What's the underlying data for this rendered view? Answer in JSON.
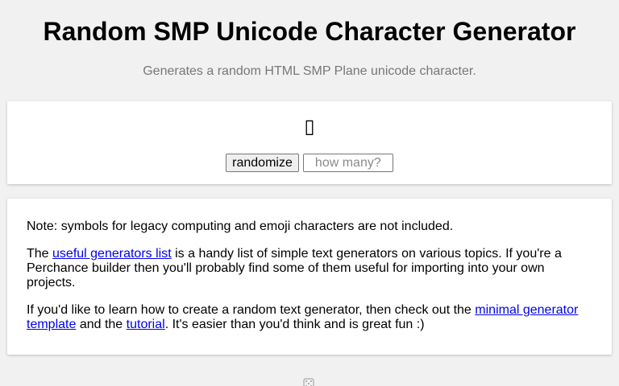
{
  "header": {
    "title": "Random SMP Unicode Character Generator",
    "subtitle": "Generates a random HTML SMP Plane unicode character."
  },
  "output": {
    "character": "▯"
  },
  "controls": {
    "randomize_label": "randomize",
    "how_many_placeholder": "how many?"
  },
  "notes": {
    "note": "Note: symbols for legacy computing and emoji characters are not included.",
    "p2_before": "The ",
    "p2_link": "useful generators list",
    "p2_after": " is a handy list of simple text generators on various topics. If you're a Perchance builder then you'll probably find some of them useful for importing into your own projects.",
    "p3_before": "If you'd like to learn how to create a random text generator, then check out the ",
    "p3_link1": "minimal generator template",
    "p3_mid": " and the ",
    "p3_link2": "tutorial",
    "p3_after": ". It's easier than you'd think and is great fun :)"
  },
  "footer": {
    "icon": "dice-icon"
  }
}
